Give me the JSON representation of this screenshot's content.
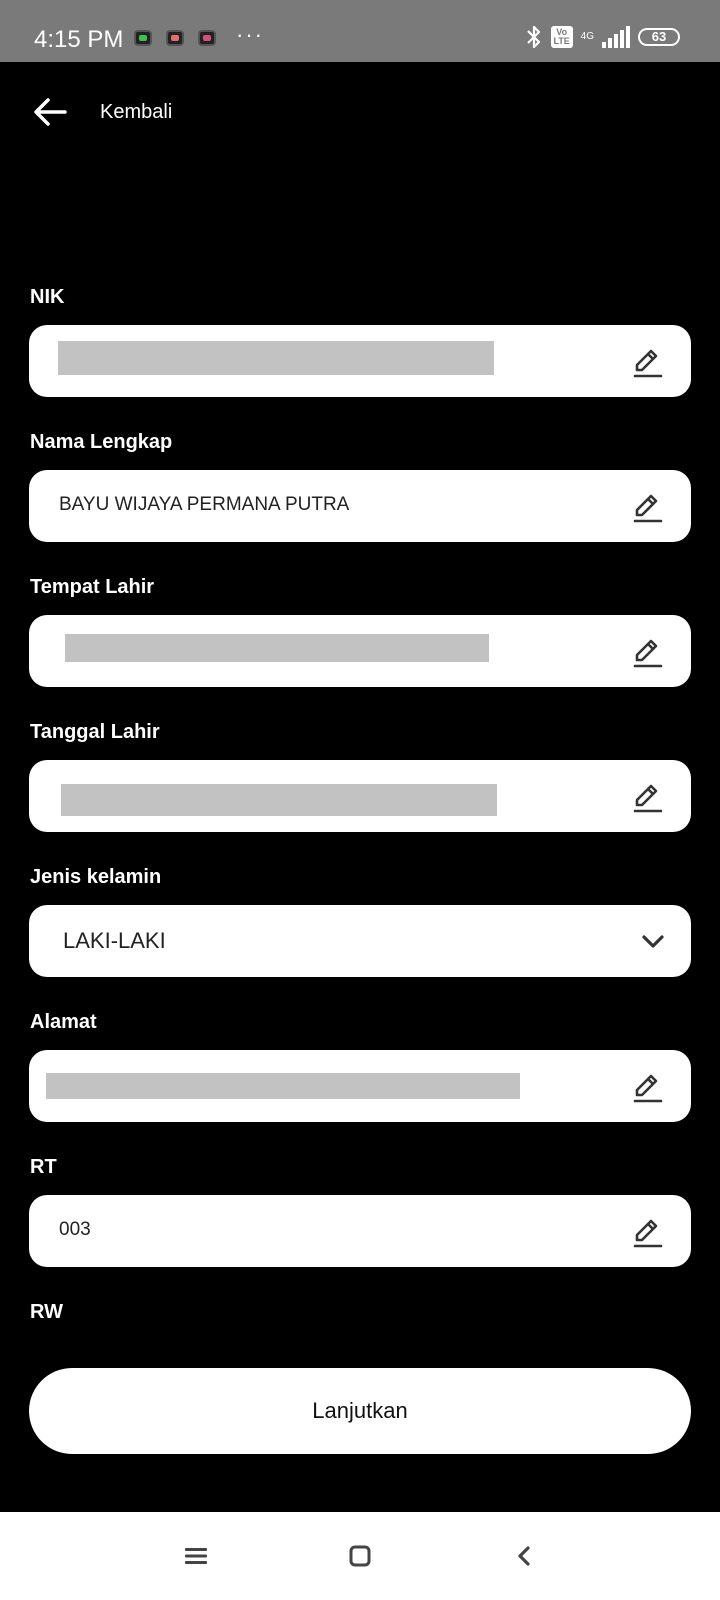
{
  "status_bar": {
    "time": "4:15 PM",
    "more": "···",
    "volte": "Vo LTE",
    "network": "4G",
    "battery": "63"
  },
  "header": {
    "back_label": "Kembali"
  },
  "form": {
    "nik": {
      "label": "NIK",
      "value": ""
    },
    "nama_lengkap": {
      "label": "Nama Lengkap",
      "value": "BAYU WIJAYA PERMANA PUTRA"
    },
    "tempat_lahir": {
      "label": "Tempat Lahir",
      "value": ""
    },
    "tanggal_lahir": {
      "label": "Tanggal Lahir",
      "value": ""
    },
    "jenis_kelamin": {
      "label": "Jenis kelamin",
      "value": "LAKI-LAKI"
    },
    "alamat": {
      "label": "Alamat",
      "value": ""
    },
    "rt": {
      "label": "RT",
      "value": "003"
    },
    "rw": {
      "label": "RW"
    }
  },
  "submit_label": "Lanjutkan",
  "icons": {
    "edit": "pencil-icon",
    "dropdown": "chevron-down-icon",
    "back": "arrow-left-icon"
  },
  "colors": {
    "background": "#000000",
    "field": "#ffffff",
    "status_bar": "#7a7a7a",
    "redaction": "#c2c2c2"
  }
}
